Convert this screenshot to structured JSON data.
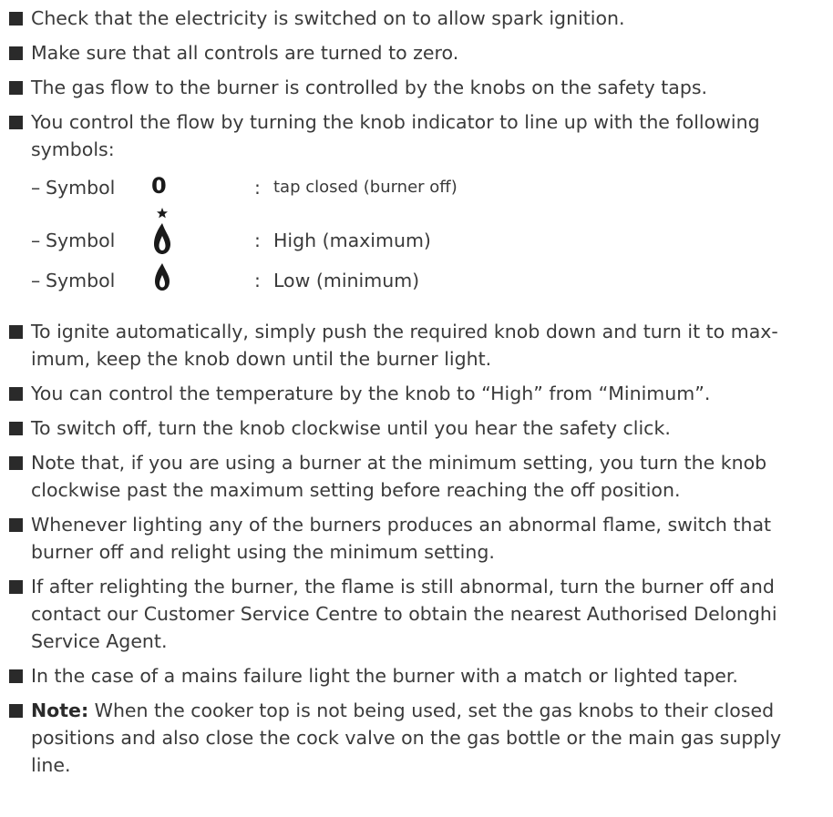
{
  "items": [
    "Check that the electricity is switched on to allow spark ignition.",
    "Make sure that all controls are turned to zero.",
    "The gas flow to the burner is controlled by the knobs on the safety taps.",
    "You control the flow by turning the knob indicator to line up with the following symbols:",
    "To ignite automatically, simply push the required knob down and turn it to max-imum, keep the knob down until the burner light.",
    "You can control the temperature by the knob to “High” from “Minimum”.",
    "To switch off, turn the knob clockwise until you hear the safety click.",
    "Note that, if you are using a burner at the minimum setting, you turn the knob clockwise past the maximum setting before reaching the off position.",
    "Whenever lighting any of the burners produces an abnormal flame, switch that burner off and relight using the minimum setting.",
    "If after relighting the burner, the flame is still abnormal, turn the burner off and contact our Customer Service Centre to obtain the nearest Authorised Delonghi Service Agent.",
    "In the case of a mains failure light the burner with a match or lighted taper."
  ],
  "note": {
    "label": "Note:",
    "text": " When  the cooker top is not being used, set the gas knobs to their closed positions and also close the cock valve on the gas bottle or the main gas supply line."
  },
  "symbols": [
    {
      "dash": "–",
      "word": "Symbol",
      "glyph": "0",
      "icon": "zero-symbol-icon",
      "colon": ":",
      "desc": "tap closed (burner off)"
    },
    {
      "dash": "–",
      "word": "Symbol",
      "icon": "flame-spark-icon",
      "colon": ":",
      "desc": "High (maximum)"
    },
    {
      "dash": "–",
      "word": "Symbol",
      "icon": "small-flame-icon",
      "colon": ":",
      "desc": "Low (minimum)"
    }
  ]
}
